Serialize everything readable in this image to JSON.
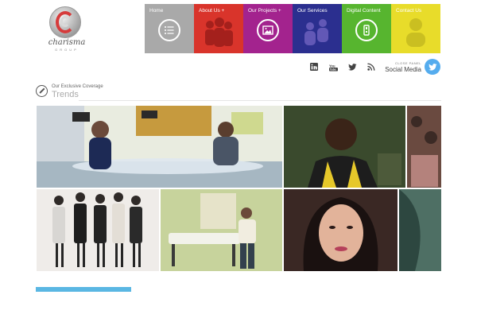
{
  "brand": {
    "name": "charisma",
    "sub": "GROUP"
  },
  "nav": [
    {
      "label": "Home",
      "color": "#a9a9a9",
      "icon": "list-icon"
    },
    {
      "label": "About Us +",
      "color": "#d9342b",
      "icon": "crowd-art"
    },
    {
      "label": "Our Projects +",
      "color": "#a3238e",
      "icon": "image-icon"
    },
    {
      "label": "Our Services",
      "color": "#2b2f8f",
      "icon": "people-art"
    },
    {
      "label": "Digital Content",
      "color": "#57b52f",
      "icon": "phone-icon"
    },
    {
      "label": "Contact Us",
      "color": "#e8dc2a",
      "icon": "person-art"
    }
  ],
  "social": {
    "icons": [
      "linkedin-icon",
      "youtube-icon",
      "twitter-icon",
      "rss-icon"
    ],
    "panel_small": "CLOSE PANEL",
    "panel_big": "Social Media"
  },
  "section": {
    "pretitle": "Our Exclusive Coverage",
    "title": "Trends"
  },
  "colors": {
    "accent": "#5ab7e3"
  }
}
